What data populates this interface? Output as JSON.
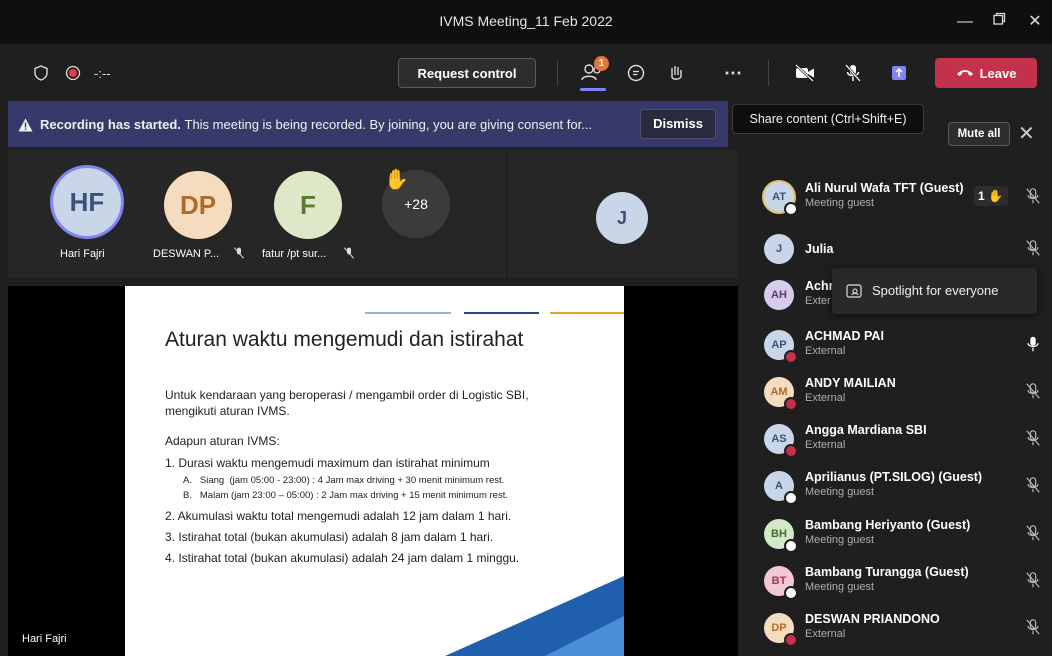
{
  "window": {
    "title": "IVMS Meeting_11 Feb 2022"
  },
  "toolbar": {
    "timer": "-:--",
    "request_control": "Request control",
    "participants_badge": "1",
    "leave": "Leave"
  },
  "banner": {
    "bold": "Recording has started.",
    "text": "This meeting is being recorded. By joining, you are giving consent for...",
    "dismiss": "Dismiss"
  },
  "tooltip": "Share content (Ctrl+Shift+E)",
  "gallery": [
    {
      "initials": "HF",
      "name": "Hari Fajri"
    },
    {
      "initials": "DP",
      "name": "DESWAN P..."
    },
    {
      "initials": "F",
      "name": "fatur /pt sur..."
    },
    {
      "initials": "+28",
      "name": ""
    }
  ],
  "spotlight_tile": {
    "initials": "J"
  },
  "slide": {
    "title": "Aturan waktu mengemudi dan istirahat",
    "intro1": "Untuk kendaraan yang beroperasi / mengambil order di Logistic SBI,",
    "intro2": "mengikuti aturan IVMS.",
    "heading": "Adapun aturan IVMS:",
    "r1": "1. Durasi waktu mengemudi maximum dan istirahat minimum",
    "r1a": "A.   Siang  (jam 05:00 - 23:00) : 4 Jam max driving + 30 menit minimum rest.",
    "r1b": "B.   Malam (jam 23:00 – 05:00) : 2 Jam max driving + 15 menit minimum rest.",
    "r2": "2. Akumulasi waktu total mengemudi adalah 12 jam dalam 1 hari.",
    "r3": "3. Istirahat total (bukan akumulasi) adalah 8 jam dalam 1 hari.",
    "r4": "4. Istirahat total (bukan akumulasi) adalah 24 jam dalam 1 minggu."
  },
  "presenter": "Hari Fajri",
  "panel": {
    "mute_all": "Mute all",
    "participants": [
      {
        "initials": "AT",
        "name": "Ali Nurul Wafa TFT (Guest)",
        "sub": "Meeting guest",
        "hand": "1",
        "mic": "off"
      },
      {
        "initials": "J",
        "name": "Julia",
        "sub": "",
        "mic": "off"
      },
      {
        "initials": "AH",
        "name": "Achr",
        "sub": "Exter",
        "mic": "none"
      },
      {
        "initials": "AP",
        "name": "ACHMAD PAI",
        "sub": "External",
        "mic": "on"
      },
      {
        "initials": "AM",
        "name": "ANDY MAILIAN",
        "sub": "External",
        "mic": "off"
      },
      {
        "initials": "AS",
        "name": "Angga Mardiana SBI",
        "sub": "External",
        "mic": "off"
      },
      {
        "initials": "A",
        "name": "Aprilianus (PT.SILOG) (Guest)",
        "sub": "Meeting guest",
        "mic": "off"
      },
      {
        "initials": "BH",
        "name": "Bambang Heriyanto (Guest)",
        "sub": "Meeting guest",
        "mic": "off"
      },
      {
        "initials": "BT",
        "name": "Bambang Turangga (Guest)",
        "sub": "Meeting guest",
        "mic": "off"
      },
      {
        "initials": "DP",
        "name": "DESWAN PRIANDONO",
        "sub": "External",
        "mic": "off"
      }
    ],
    "spotlight_menu": "Spotlight for everyone"
  },
  "colors": {
    "accent": "#7f85f5",
    "leave": "#c4314b",
    "banner": "#37396b"
  }
}
